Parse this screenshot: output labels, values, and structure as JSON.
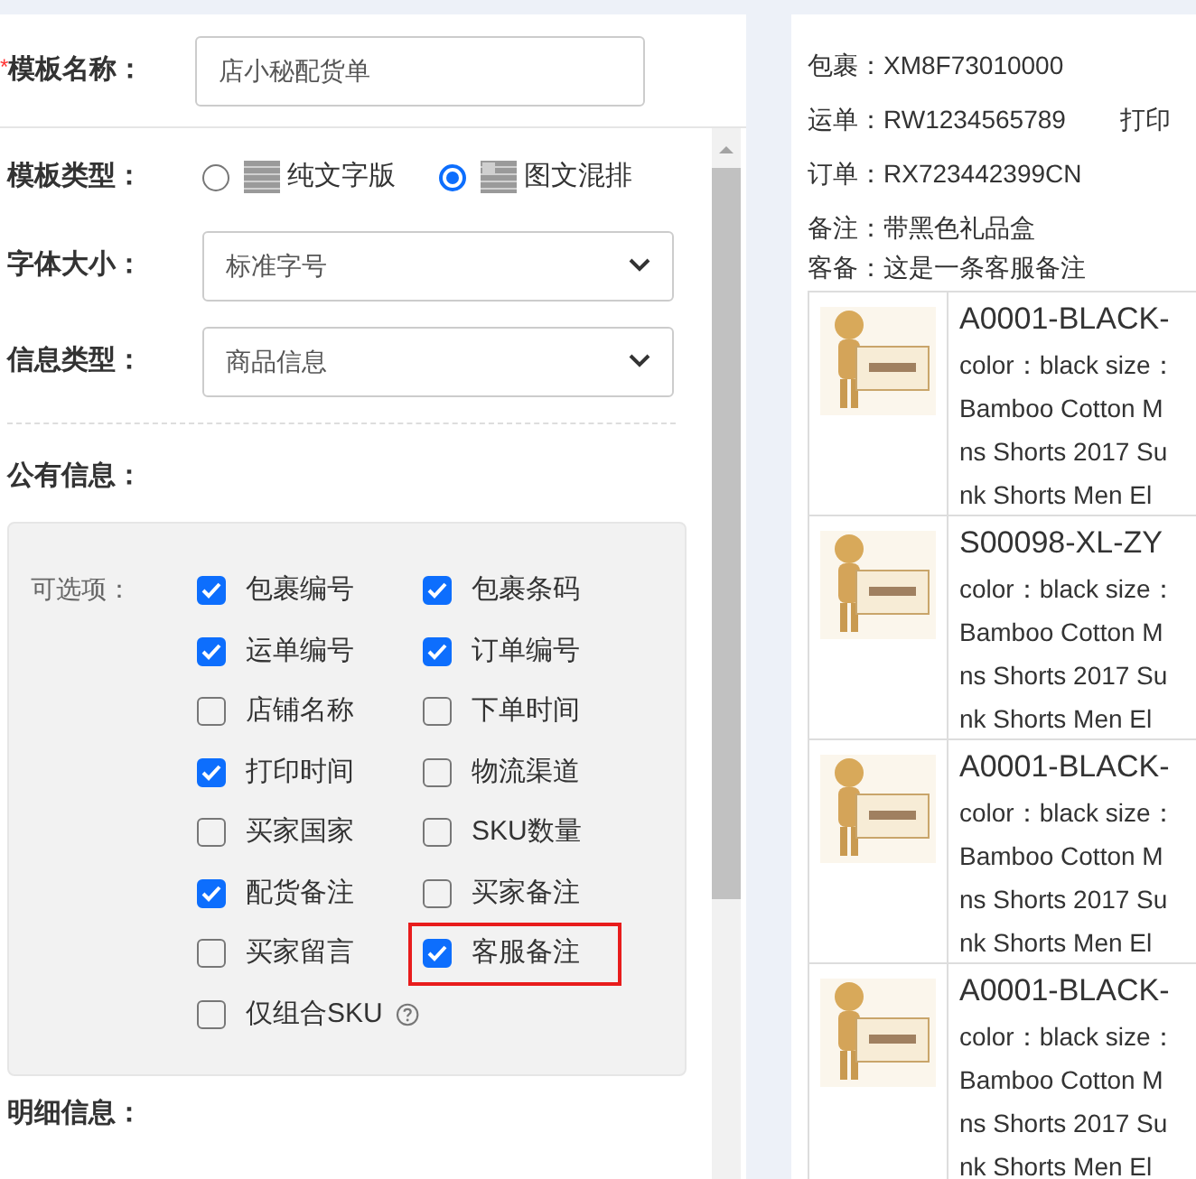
{
  "template_name": {
    "required_mark": "*",
    "label": "模板名称：",
    "value": "店小秘配货单"
  },
  "template_type": {
    "label": "模板类型：",
    "options": [
      {
        "label": "纯文字版",
        "selected": false,
        "kind": "text"
      },
      {
        "label": "图文混排",
        "selected": true,
        "kind": "image"
      }
    ]
  },
  "font_size": {
    "label": "字体大小：",
    "value": "标准字号"
  },
  "info_type": {
    "label": "信息类型：",
    "value": "商品信息"
  },
  "public_info": {
    "title": "公有信息：",
    "options_label": "可选项：",
    "options": [
      {
        "label": "包裹编号",
        "checked": true,
        "highlighted": false
      },
      {
        "label": "包裹条码",
        "checked": true,
        "highlighted": false
      },
      {
        "label": "运单编号",
        "checked": true,
        "highlighted": false
      },
      {
        "label": "订单编号",
        "checked": true,
        "highlighted": false
      },
      {
        "label": "店铺名称",
        "checked": false,
        "highlighted": false
      },
      {
        "label": "下单时间",
        "checked": false,
        "highlighted": false
      },
      {
        "label": "打印时间",
        "checked": true,
        "highlighted": false
      },
      {
        "label": "物流渠道",
        "checked": false,
        "highlighted": false
      },
      {
        "label": "买家国家",
        "checked": false,
        "highlighted": false
      },
      {
        "label": "SKU数量",
        "checked": false,
        "highlighted": false
      },
      {
        "label": "配货备注",
        "checked": true,
        "highlighted": false
      },
      {
        "label": "买家备注",
        "checked": false,
        "highlighted": false
      },
      {
        "label": "买家留言",
        "checked": false,
        "highlighted": false
      },
      {
        "label": "客服备注",
        "checked": true,
        "highlighted": true
      },
      {
        "label": "仅组合SKU",
        "checked": false,
        "highlighted": false,
        "help": true
      }
    ]
  },
  "detail_info": {
    "title": "明细信息："
  },
  "preview": {
    "lines": [
      {
        "items": [
          {
            "label": "包裹：",
            "value": "XM8F73010000"
          }
        ]
      },
      {
        "items": [
          {
            "label": "运单：",
            "value": "RW1234565789"
          },
          {
            "label": "打印"
          }
        ]
      },
      {
        "items": [
          {
            "label": "订单：",
            "value": "RX723442399CN"
          }
        ]
      },
      {
        "items": [
          {
            "label": "备注：",
            "value": "带黑色礼品盒"
          }
        ]
      },
      {
        "items": [
          {
            "label": "客备：",
            "value": "这是一条客服备注"
          }
        ]
      }
    ],
    "products": [
      {
        "sku": "A0001-BLACK-",
        "lines": [
          "color：black size：",
          "Bamboo Cotton M",
          "ns Shorts 2017 Su",
          "nk Shorts Men El"
        ]
      },
      {
        "sku": "S00098-XL-ZY",
        "lines": [
          "color：black size：",
          "Bamboo Cotton M",
          "ns Shorts 2017 Su",
          "nk Shorts Men El"
        ]
      },
      {
        "sku": "A0001-BLACK-",
        "lines": [
          "color：black size：",
          "Bamboo Cotton M",
          "ns Shorts 2017 Su",
          "nk Shorts Men El"
        ]
      },
      {
        "sku": "A0001-BLACK-",
        "lines": [
          "color：black size：",
          "Bamboo Cotton M",
          "ns Shorts 2017 Su",
          "nk Shorts Men El"
        ]
      }
    ]
  }
}
